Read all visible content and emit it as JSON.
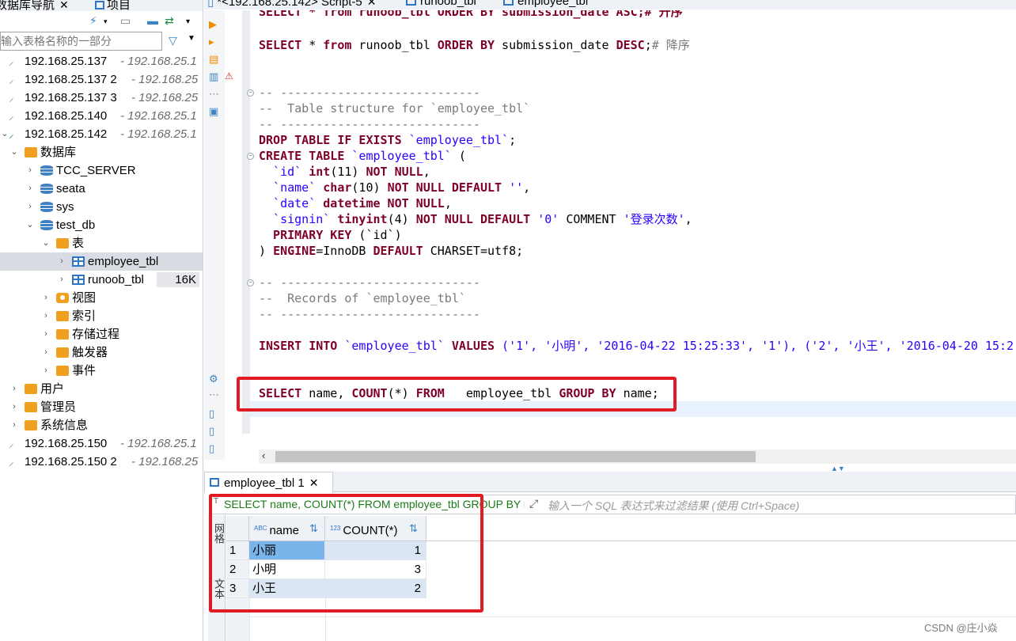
{
  "navigator": {
    "tab_label": "数据库导航",
    "project_tab_label": "项目",
    "filter_placeholder": "输入表格名称的一部分",
    "tree": [
      {
        "id": "c137",
        "label": "192.168.25.137",
        "sub": "- 192.168.25.1"
      },
      {
        "id": "c1372",
        "label": "192.168.25.137 2",
        "sub": "- 192.168.25"
      },
      {
        "id": "c1373",
        "label": "192.168.25.137 3",
        "sub": "- 192.168.25"
      },
      {
        "id": "c140",
        "label": "192.168.25.140",
        "sub": "- 192.168.25.1"
      },
      {
        "id": "c142",
        "label": "192.168.25.142",
        "sub": "- 192.168.25.1"
      },
      {
        "id": "databases",
        "label": "数据库"
      },
      {
        "id": "tcc",
        "label": "TCC_SERVER"
      },
      {
        "id": "seata",
        "label": "seata"
      },
      {
        "id": "sys",
        "label": "sys"
      },
      {
        "id": "testdb",
        "label": "test_db"
      },
      {
        "id": "tables",
        "label": "表"
      },
      {
        "id": "emp",
        "label": "employee_tbl"
      },
      {
        "id": "runoob",
        "label": "runoob_tbl",
        "size": "16K"
      },
      {
        "id": "views",
        "label": "视图"
      },
      {
        "id": "indexes",
        "label": "索引"
      },
      {
        "id": "procs",
        "label": "存储过程"
      },
      {
        "id": "triggers",
        "label": "触发器"
      },
      {
        "id": "events",
        "label": "事件"
      },
      {
        "id": "users",
        "label": "用户"
      },
      {
        "id": "admins",
        "label": "管理员"
      },
      {
        "id": "sysinfo",
        "label": "系统信息"
      },
      {
        "id": "c150",
        "label": "192.168.25.150",
        "sub": "- 192.168.25.1"
      },
      {
        "id": "c1502",
        "label": "192.168.25.150 2",
        "sub": "- 192.168.25"
      }
    ]
  },
  "editor": {
    "tabs": [
      {
        "label": "*<192.168.25.142> Script-5"
      },
      {
        "label": "runoob_tbl"
      },
      {
        "label": "employee_tbl"
      }
    ],
    "line_top_partial": "SELECT * from runoob_tbl ORDER BY submission_date ASC;# 升序",
    "l1_a": "SELECT",
    "l1_b": " * ",
    "l1_c": "from",
    "l1_d": " runoob_tbl ",
    "l1_e": "ORDER BY",
    "l1_f": " submission_date ",
    "l1_g": "DESC",
    "l1_h": ";",
    "l1_i": "# 降序",
    "c1": "-- ----------------------------",
    "c2": "--  Table structure for `employee_tbl`",
    "c3": "-- ----------------------------",
    "drop_kw": "DROP TABLE IF EXISTS",
    "drop_name": " `employee_tbl`",
    "drop_end": ";",
    "create_kw": "CREATE TABLE",
    "create_name": " `employee_tbl`",
    "create_end": " (",
    "f1_name": "  `id`",
    "f1_type": " int",
    "f1_rest_a": "(11) ",
    "f1_rest_b": "NOT NULL",
    "f1_rest_c": ",",
    "f2_name": "  `name`",
    "f2_type": " char",
    "f2_rest_a": "(10) ",
    "f2_rest_b": "NOT NULL DEFAULT",
    "f2_rest_c": " ''",
    "f2_rest_d": ",",
    "f3_name": "  `date`",
    "f3_type": " datetime",
    "f3_rest_b": " NOT NULL",
    "f3_rest_c": ",",
    "f4_name": "  `signin`",
    "f4_type": " tinyint",
    "f4_rest_a": "(4) ",
    "f4_rest_b": "NOT NULL DEFAULT",
    "f4_rest_c": " '0'",
    "f4_rest_d": " COMMENT ",
    "f4_rest_e": "'登录次数'",
    "f4_rest_f": ",",
    "pk_kw": "  PRIMARY KEY",
    "pk_rest": " (`id`)",
    "eng_a": ") ",
    "eng_b": "ENGINE",
    "eng_c": "=InnoDB ",
    "eng_d": "DEFAULT",
    "eng_e": " CHARSET=utf8;",
    "r1": "-- ----------------------------",
    "r2": "--  Records of `employee_tbl`",
    "r3": "-- ----------------------------",
    "ins_kw": "INSERT INTO",
    "ins_name": " `employee_tbl`",
    "ins_kw2": " VALUES",
    "ins_vals": " ('1', '小明', '2016-04-22 15:25:33', '1'), ('2', '小王', '2016-04-20 15:2",
    "sel_kw": "SELECT",
    "sel_a": " name, ",
    "sel_fn": "COUNT",
    "sel_b": "(*) ",
    "sel_from": "FROM",
    "sel_c": "   employee_tbl ",
    "sel_grp": "GROUP BY",
    "sel_d": " name;"
  },
  "results": {
    "tab_label": "employee_tbl 1",
    "query_text": "SELECT name, COUNT(*) FROM employee_tbl GROUP BY name",
    "filter_placeholder": "输入一个 SQL 表达式来过滤结果 (使用 Ctrl+Space)",
    "side_label_grid": "网格",
    "side_label_text": "文本",
    "columns": [
      {
        "type": "ABC",
        "label": "name"
      },
      {
        "type": "123",
        "label": "COUNT(*)"
      }
    ],
    "rows": [
      {
        "n": "1",
        "name": "小丽",
        "count": "1"
      },
      {
        "n": "2",
        "name": "小明",
        "count": "3"
      },
      {
        "n": "3",
        "name": "小王",
        "count": "2"
      }
    ]
  },
  "watermark": "CSDN @庄小焱",
  "colors": {
    "annotation": "#e01b24",
    "keyword": "#7f0026",
    "string": "#2a00ff",
    "selection": "#7bb4ea"
  }
}
